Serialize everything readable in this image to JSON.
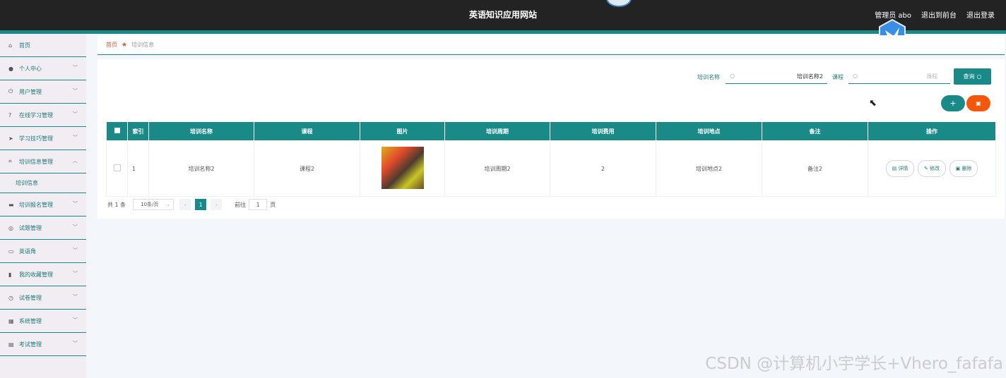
{
  "header": {
    "title": "英语知识应用网站",
    "admin": "管理员 abo",
    "back_to_front": "退出到前台",
    "logout": "退出登录"
  },
  "sidebar": {
    "items": [
      {
        "label": "首页",
        "icon": "home-icon",
        "glyph": "⌂",
        "chevron": false
      },
      {
        "label": "个人中心",
        "icon": "user-icon",
        "glyph": "●",
        "chevron": true
      },
      {
        "label": "用户管理",
        "icon": "power-icon",
        "glyph": "⏻",
        "chevron": true
      },
      {
        "label": "在线学习管理",
        "icon": "question-icon",
        "glyph": "?",
        "chevron": true
      },
      {
        "label": "学习技巧管理",
        "icon": "send-icon",
        "glyph": "➤",
        "chevron": true
      },
      {
        "label": "培训信息管理",
        "icon": "crop-icon",
        "glyph": "⌗",
        "chevron": true
      }
    ],
    "sub_item": "培训信息",
    "items_after": [
      {
        "label": "培训报名管理",
        "icon": "chat-icon",
        "glyph": "▬",
        "chevron": true
      },
      {
        "label": "试题管理",
        "icon": "target-icon",
        "glyph": "◎",
        "chevron": true
      },
      {
        "label": "英语角",
        "icon": "briefcase-icon",
        "glyph": "▭",
        "chevron": true
      },
      {
        "label": "我的收藏管理",
        "icon": "bookmark-icon",
        "glyph": "▮",
        "chevron": true
      },
      {
        "label": "试卷管理",
        "icon": "clock-icon",
        "glyph": "◷",
        "chevron": true
      },
      {
        "label": "系统管理",
        "icon": "calendar-icon",
        "glyph": "▦",
        "chevron": true
      },
      {
        "label": "考试管理",
        "icon": "clipboard-icon",
        "glyph": "▤",
        "chevron": true
      }
    ]
  },
  "breadcrumb": {
    "home": "首页",
    "current": "培训信息"
  },
  "search": {
    "name_label": "培训名称",
    "name_value": "培训名称2",
    "course_label": "课程",
    "course_placeholder": "课程",
    "query_label": "查询"
  },
  "table": {
    "headers": [
      "索引",
      "培训名称",
      "课程",
      "图片",
      "培训周期",
      "培训费用",
      "培训地点",
      "备注",
      "操作"
    ],
    "rows": [
      {
        "index": "1",
        "name": "培训名称2",
        "course": "课程2",
        "period": "培训周期2",
        "fee": "2",
        "location": "培训地点2",
        "remark": "备注2"
      }
    ],
    "actions": {
      "detail": "详情",
      "edit": "修改",
      "delete": "删除"
    }
  },
  "pagination": {
    "total": "共 1 条",
    "page_size": "10条/页",
    "current_page": "1",
    "goto_label": "前往",
    "goto_value": "1",
    "page_suffix": "页"
  },
  "watermark": "CSDN @计算机小宇学长+Vhero_fafafa",
  "colors": {
    "primary": "#1a8a89",
    "danger": "#f2570c",
    "topbar": "#232323"
  }
}
